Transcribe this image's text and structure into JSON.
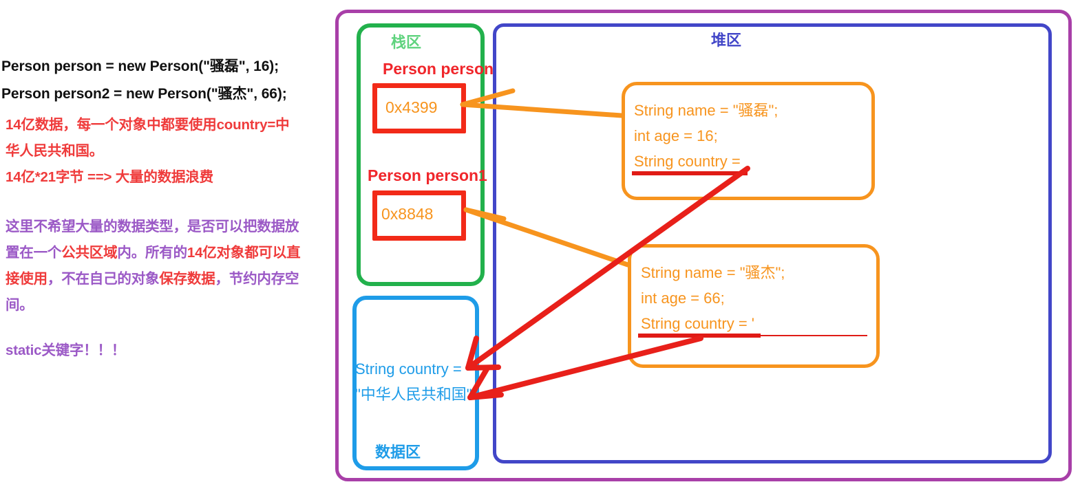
{
  "notes": {
    "code_lines": [
      "Person person = new Person(\"骚磊\", 16);",
      "Person person2 = new Person(\"骚杰\", 66);"
    ],
    "red_lines": [
      "14亿数据，每一个对象中都要使用country=中",
      "华人民共和国。",
      "14亿*21字节 ==> 大量的数据浪费"
    ],
    "purple_lines": [
      "这里不希望大量的数据类型，是否可以把数据放",
      "置在一个公共区域内。所有的14亿对象都可以直",
      "接使用，不在自己的对象保存数据，节约内存空",
      "间。"
    ],
    "static_line": "static关键字！！！"
  },
  "diagram": {
    "stack": {
      "title": "栈区",
      "vars": [
        {
          "name": "Person person",
          "address": "0x4399"
        },
        {
          "name": "Person person1",
          "address": "0x8848"
        }
      ]
    },
    "data_area": {
      "title": "数据区",
      "lines": [
        "String country =",
        "\"中华人民共和国\""
      ]
    },
    "heap": {
      "title": "堆区",
      "objects": [
        {
          "lines": [
            "String name = \"骚磊\";",
            "int age = 16;",
            "String country ="
          ]
        },
        {
          "lines": [
            "String name = \"骚杰\";",
            "int age = 66;",
            "String country = '"
          ]
        }
      ]
    }
  },
  "colors": {
    "outer_border": "#a83fa8",
    "stack_border": "#22b14c",
    "heap_border": "#4246c8",
    "data_border": "#1e9ce8",
    "slot_border": "#f22a18",
    "object_border": "#f7941e",
    "orange_arrow": "#f7941e",
    "red_arrow": "#e01b16",
    "red_text": "#ef3b3b",
    "purple_text": "#9b59c6",
    "code_text": "#111111"
  }
}
